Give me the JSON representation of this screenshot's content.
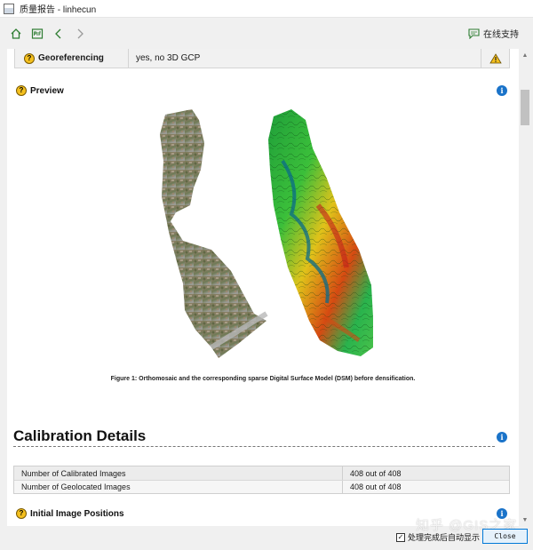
{
  "window": {
    "title": "质量报告 - linhecun"
  },
  "toolbar": {
    "support_label": "在线支持"
  },
  "report": {
    "georef_row": {
      "label": "Georeferencing",
      "value": "yes, no 3D GCP",
      "status": "warning"
    },
    "preview": {
      "heading": "Preview",
      "caption": "Figure 1: Orthomosaic and the corresponding sparse Digital Surface Model (DSM) before densification."
    },
    "calibration": {
      "heading": "Calibration Details",
      "rows": [
        {
          "label": "Number of Calibrated Images",
          "value": "408 out of 408"
        },
        {
          "label": "Number of Geolocated Images",
          "value": "408 out of 408"
        }
      ]
    },
    "next_section": {
      "heading": "Initial Image Positions"
    }
  },
  "footer": {
    "auto_show_label": "处理完成后自动显示",
    "auto_show_checked": true,
    "close_label": "Close",
    "watermark": "知乎 @GIS之家"
  },
  "colors": {
    "accent": "#0078d7",
    "help_icon": "#f4c01e",
    "info_icon": "#1a73c9",
    "warning": "#f4c01e"
  }
}
